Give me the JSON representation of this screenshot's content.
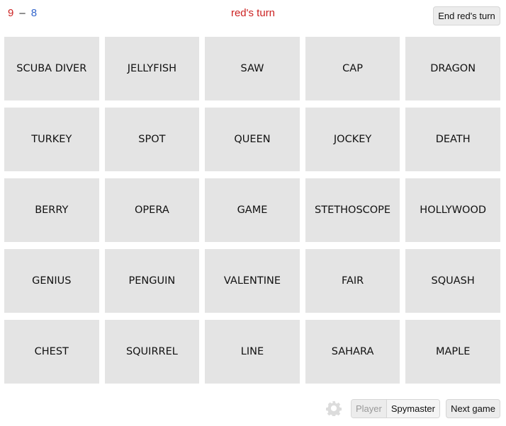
{
  "score": {
    "red": "9",
    "separator": "–",
    "blue": "8"
  },
  "turn_text": "red's turn",
  "end_turn_label": "End red's turn",
  "cards": [
    "SCUBA DIVER",
    "JELLYFISH",
    "SAW",
    "CAP",
    "DRAGON",
    "TURKEY",
    "SPOT",
    "QUEEN",
    "JOCKEY",
    "DEATH",
    "BERRY",
    "OPERA",
    "GAME",
    "STETHOSCOPE",
    "HOLLYWOOD",
    "GENIUS",
    "PENGUIN",
    "VALENTINE",
    "FAIR",
    "SQUASH",
    "CHEST",
    "SQUIRREL",
    "LINE",
    "SAHARA",
    "MAPLE"
  ],
  "footer": {
    "settings_icon": "gear-icon",
    "mode_toggle": {
      "options": [
        "Player",
        "Spymaster"
      ],
      "selected": "Spymaster"
    },
    "next_game_label": "Next game"
  },
  "colors": {
    "red": "#cc2222",
    "blue": "#3366cc",
    "card_bg": "#e4e4e4"
  }
}
